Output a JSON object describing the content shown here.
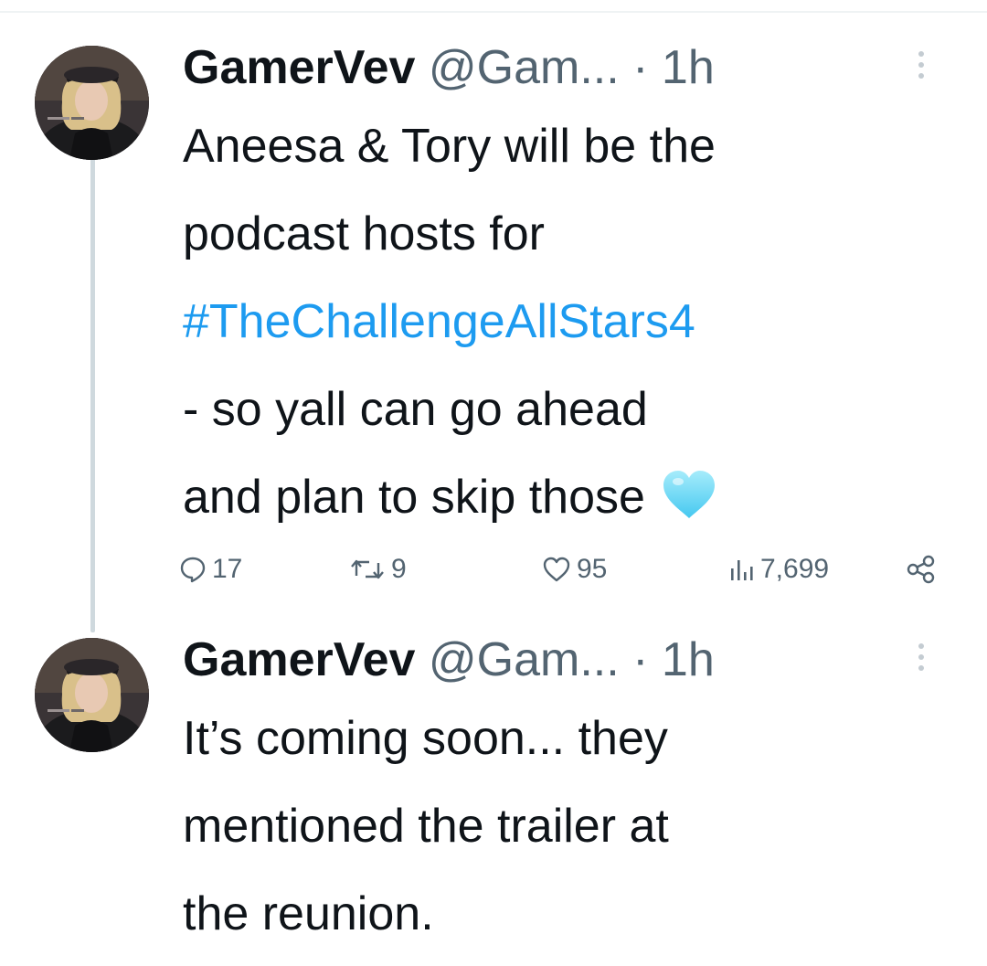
{
  "thread": {
    "tweets": [
      {
        "display_name": "GamerVev",
        "handle": "@Gam...",
        "separator": "·",
        "time": "1h",
        "lines": [
          "Aneesa & Tory will be the",
          "podcast hosts for",
          "#TheChallengeAllStars4",
          "- so yall can go ahead",
          "and plan to skip those"
        ],
        "emoji": "light-blue-heart",
        "stats": {
          "replies": "17",
          "retweets": "9",
          "likes": "95",
          "views": "7,699"
        }
      },
      {
        "display_name": "GamerVev",
        "handle": "@Gam...",
        "separator": "·",
        "time": "1h",
        "lines": [
          "It’s coming soon... they",
          "mentioned the trailer at",
          "the reunion."
        ]
      }
    ]
  },
  "icons": {
    "reply": "reply-icon",
    "retweet": "retweet-icon",
    "like": "heart-icon",
    "views": "views-icon",
    "share": "share-icon",
    "more": "more-vertical-icon"
  },
  "colors": {
    "text": "#0f1419",
    "secondary": "#536471",
    "hashtag": "#1d9bf0",
    "thread_line": "#cfd9de",
    "heart_emoji": "#7fd8f5"
  }
}
